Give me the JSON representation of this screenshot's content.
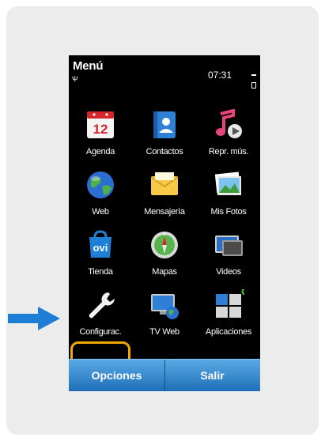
{
  "screen": {
    "title": "Menú",
    "time": "07:31",
    "signal_icon": "antenna-icon",
    "battery_icon": "battery-icon"
  },
  "menu": {
    "items": [
      {
        "label": "Agenda",
        "icon": "calendar-icon",
        "calendar_day": "12"
      },
      {
        "label": "Contactos",
        "icon": "contacts-icon"
      },
      {
        "label": "Repr. mús.",
        "icon": "music-player-icon"
      },
      {
        "label": "Web",
        "icon": "globe-icon"
      },
      {
        "label": "Mensajería",
        "icon": "envelope-icon"
      },
      {
        "label": "Mis Fotos",
        "icon": "photos-icon"
      },
      {
        "label": "Tienda",
        "icon": "ovi-store-icon",
        "badge_text": "ovi"
      },
      {
        "label": "Mapas",
        "icon": "compass-icon",
        "compass_letter": "N"
      },
      {
        "label": "Videos",
        "icon": "video-icon"
      },
      {
        "label": "Configurac.",
        "icon": "wrench-icon"
      },
      {
        "label": "TV Web",
        "icon": "web-tv-icon"
      },
      {
        "label": "Aplicaciones",
        "icon": "applications-icon"
      }
    ],
    "selected_index": 9
  },
  "softkeys": {
    "left": "Opciones",
    "right": "Salir"
  },
  "colors": {
    "highlight": "#f2a800",
    "pointer_arrow": "#1e7ed6",
    "softkey_bar": "#3d8fd3"
  },
  "pointer_icon": "right-arrow-icon"
}
